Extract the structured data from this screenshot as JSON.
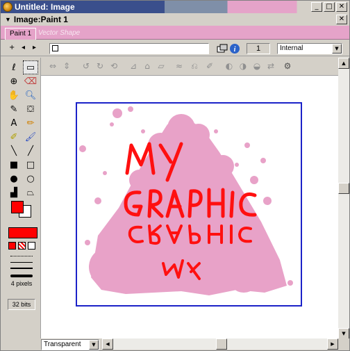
{
  "window": {
    "title": "Untitled: Image",
    "buttons": [
      "_",
      "□",
      "✕"
    ]
  },
  "document": {
    "title": "Image:Paint 1",
    "close": "✕"
  },
  "tabs": [
    {
      "label": "Paint 1"
    },
    {
      "label": "Vector Shape"
    }
  ],
  "toolbar": {
    "nav": [
      "+",
      "◂",
      "▸"
    ],
    "object_name": "",
    "frame": "1",
    "ink": "Internal"
  },
  "tools_panel": {
    "line_width_label": "4 pixels",
    "bit_depth": "32 bits",
    "foreground_color": "#ff0000",
    "background_color": "#ffffff"
  },
  "bottom": {
    "background_mode": "Transparent"
  },
  "canvas": {
    "text_line1": "MY",
    "text_line2": "GRAPHIC",
    "reflection_line1": "GRAPHIC",
    "reflection_line2": "MY",
    "splatter_color": "#e8a2c8",
    "text_color": "#ff1010",
    "frame_color": "#1b22c8"
  }
}
